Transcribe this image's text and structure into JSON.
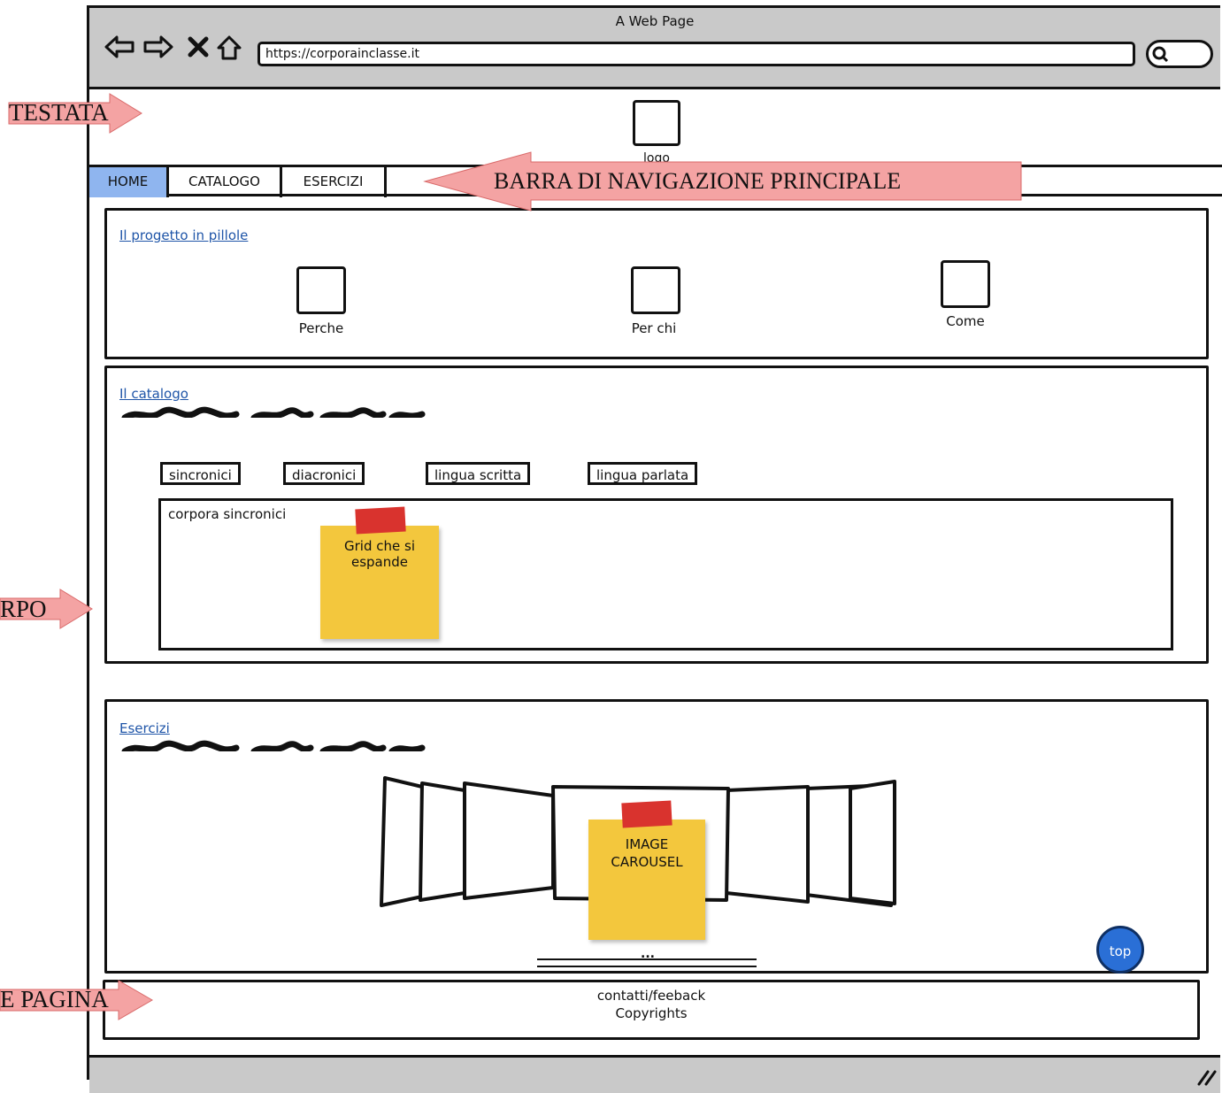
{
  "window": {
    "title": "A Web Page",
    "url": "https://corporainclasse.it"
  },
  "header": {
    "logo_label": "logo"
  },
  "nav": {
    "tabs": [
      {
        "label": "HOME",
        "active": true
      },
      {
        "label": "CATALOGO",
        "active": false
      },
      {
        "label": "ESERCIZI",
        "active": false
      }
    ]
  },
  "section_progetto": {
    "title": "Il progetto in pillole",
    "items": [
      "Perche",
      "Per chi",
      "Come"
    ]
  },
  "section_catalogo": {
    "title": "Il catalogo",
    "filters": [
      "sincronici",
      "diacronici",
      "lingua scritta",
      "lingua parlata"
    ],
    "panel_label": "corpora sincronici",
    "sticky_note": "Grid che si espande"
  },
  "section_esercizi": {
    "title": "Esercizi",
    "sticky_note": "IMAGE CAROUSEL",
    "pager": "..."
  },
  "top_button": {
    "label": "top"
  },
  "footer": {
    "line1": "contatti/feeback",
    "line2": "Copyrights"
  },
  "annotations": {
    "header": "TESTATA",
    "navbar": "BARRA DI NAVIGAZIONE PRINCIPALE",
    "body": "RPO",
    "footer": "E PAGINA"
  },
  "colors": {
    "chrome": "#c9c9c9",
    "active_tab": "#8fb5ef",
    "link": "#1f55a8",
    "sticky": "#f3c73d",
    "tape": "#d9332e",
    "annotation_arrow": "#f4a3a3",
    "top_button": "#2a6fd6"
  }
}
